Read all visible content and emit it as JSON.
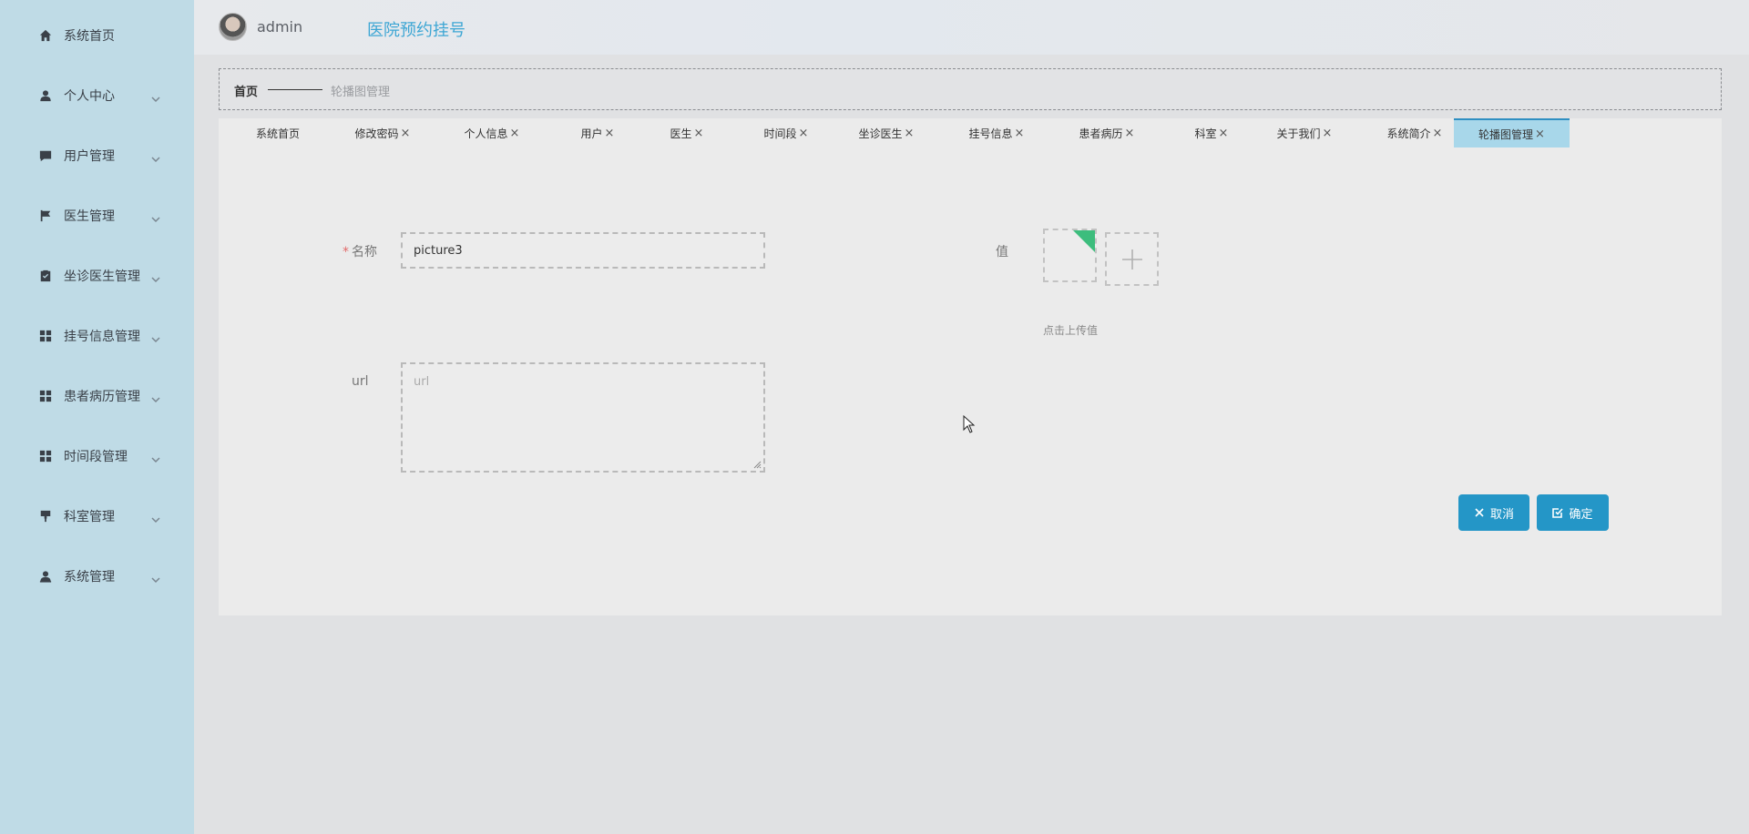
{
  "sidebar": {
    "items": [
      {
        "label": "系统首页",
        "icon": "home-icon",
        "expandable": false
      },
      {
        "label": "个人中心",
        "icon": "user-icon",
        "expandable": true
      },
      {
        "label": "用户管理",
        "icon": "chat-icon",
        "expandable": true
      },
      {
        "label": "医生管理",
        "icon": "flag-icon",
        "expandable": true
      },
      {
        "label": "坐诊医生管理",
        "icon": "clipboard-check-icon",
        "expandable": true
      },
      {
        "label": "挂号信息管理",
        "icon": "grid-icon",
        "expandable": true
      },
      {
        "label": "患者病历管理",
        "icon": "grid-icon",
        "expandable": true
      },
      {
        "label": "时间段管理",
        "icon": "grid-icon",
        "expandable": true
      },
      {
        "label": "科室管理",
        "icon": "brush-icon",
        "expandable": true
      },
      {
        "label": "系统管理",
        "icon": "admin-user-icon",
        "expandable": true
      }
    ]
  },
  "header": {
    "username": "admin",
    "title": "医院预约挂号"
  },
  "breadcrumb": {
    "home": "首页",
    "current": "轮播图管理"
  },
  "tabs": [
    {
      "label": "系统首页",
      "closable": false
    },
    {
      "label": "修改密码",
      "closable": true
    },
    {
      "label": "个人信息",
      "closable": true
    },
    {
      "label": "用户",
      "closable": true
    },
    {
      "label": "医生",
      "closable": true
    },
    {
      "label": "时间段",
      "closable": true
    },
    {
      "label": "坐诊医生",
      "closable": true
    },
    {
      "label": "挂号信息",
      "closable": true
    },
    {
      "label": "患者病历",
      "closable": true
    },
    {
      "label": "科室",
      "closable": true
    },
    {
      "label": "关于我们",
      "closable": true
    },
    {
      "label": "系统简介",
      "closable": true
    },
    {
      "label": "轮播图管理",
      "closable": true,
      "active": true
    }
  ],
  "tab_close_glyph": "×",
  "form": {
    "name_required_mark": "*",
    "name_label": "名称",
    "name_value": "picture3",
    "url_label": "url",
    "url_placeholder": "url",
    "value_label": "值",
    "upload_hint": "点击上传值"
  },
  "buttons": {
    "cancel": "取消",
    "confirm": "确定"
  },
  "colors": {
    "sidebar_bg": "#bfdbe6",
    "accent": "#2496c7",
    "title": "#3da6d4",
    "active_tab": "#a8d7ea"
  }
}
